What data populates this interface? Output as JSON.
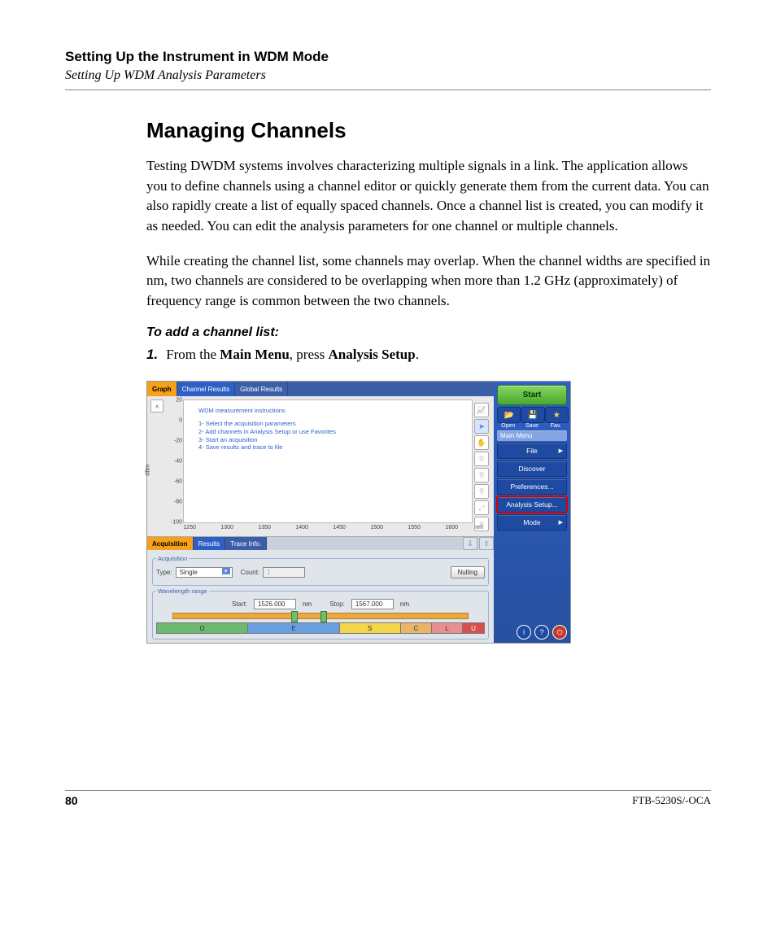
{
  "page": {
    "chapter_title": "Setting Up the Instrument in WDM Mode",
    "chapter_sub": "Setting Up WDM Analysis Parameters",
    "section_title": "Managing Channels",
    "para1": "Testing DWDM systems involves characterizing multiple signals in a link. The application allows you to define channels using a channel editor or quickly generate them from the current data. You can also rapidly create a list of equally spaced channels. Once a channel list is created, you can modify it as needed. You can edit the analysis parameters for one channel or multiple channels.",
    "para2": "While creating the channel list, some channels may overlap. When the channel widths are specified in nm, two channels are considered to be overlapping when more than 1.2 GHz (approximately) of frequency range is common between the two channels.",
    "step_heading": "To add a channel list:",
    "step1_num": "1.",
    "step1_a": "From the ",
    "step1_b": "Main Menu",
    "step1_c": ", press ",
    "step1_d": "Analysis Setup",
    "step1_e": ".",
    "page_number": "80",
    "model": "FTB-5230S/-OCA"
  },
  "shot": {
    "tabs": {
      "graph": "Graph",
      "channel": "Channel Results",
      "global": "Global Results"
    },
    "instructions": {
      "title": "WDM measurement instructions",
      "l1": "1- Select the acquisition parameters",
      "l2": "2- Add channels in Analysis Setup or use Favorites",
      "l3": "3- Start an acquisition",
      "l4": "4- Save results and trace to file"
    },
    "yaxis_label": "dBm",
    "yticks": [
      "20",
      "0",
      "-20",
      "-40",
      "-60",
      "-80",
      "-100"
    ],
    "xticks": [
      "1250",
      "1300",
      "1350",
      "1400",
      "1450",
      "1500",
      "1550",
      "1600"
    ],
    "xunit": "nm",
    "lower_tabs": {
      "acq": "Acquisition",
      "res": "Results",
      "trace": "Trace Info."
    },
    "acq": {
      "group": "Acquisition",
      "type_label": "Type:",
      "type_value": "Single",
      "count_label": "Count:",
      "count_value": "1",
      "nulling": "Nulling",
      "wl_group": "Wavelength range",
      "start_label": "Start:",
      "start_value": "1526.000",
      "start_unit": "nm",
      "stop_label": "Stop:",
      "stop_value": "1567.000",
      "stop_unit": "nm",
      "bands": [
        "O",
        "E",
        "S",
        "C",
        "L",
        "U"
      ]
    },
    "side": {
      "start": "Start",
      "open": "Open",
      "save": "Save",
      "fav": "Fav.",
      "main_menu": "Main Menu",
      "file": "File",
      "discover": "Discover",
      "prefs": "Preferences...",
      "analysis": "Analysis Setup...",
      "mode": "Mode"
    }
  },
  "chart_data": {
    "type": "line",
    "title": "",
    "xlabel": "nm",
    "ylabel": "dBm",
    "xlim": [
      1250,
      1650
    ],
    "ylim": [
      -100,
      20
    ],
    "xticks": [
      1250,
      1300,
      1350,
      1400,
      1450,
      1500,
      1550,
      1600
    ],
    "yticks": [
      20,
      0,
      -20,
      -40,
      -60,
      -80,
      -100
    ],
    "series": []
  }
}
